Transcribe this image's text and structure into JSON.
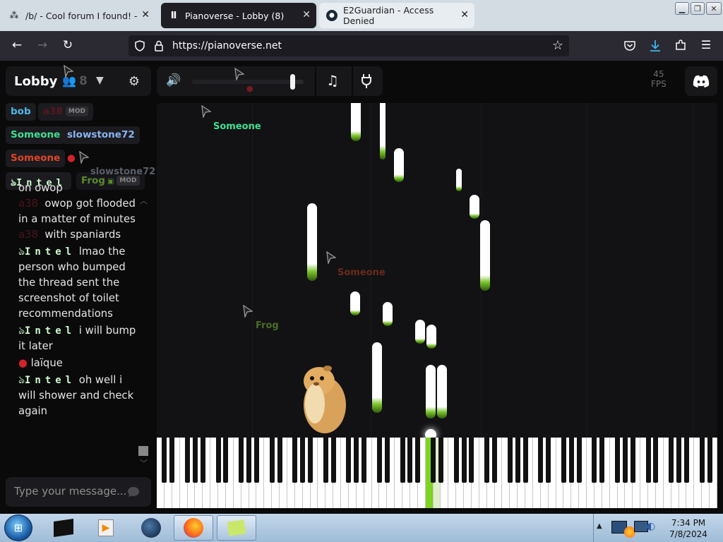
{
  "browser": {
    "tabs": [
      {
        "title": "/b/ - Cool forum I found! - Ran",
        "active": false
      },
      {
        "title": "Pianoverse - Lobby (8)",
        "active": true
      },
      {
        "title": "E2Guardian - Access Denied",
        "active": false
      }
    ],
    "url": "https://pianoverse.net"
  },
  "room": {
    "name": "Lobby",
    "user_count": "8",
    "fps_value": "45",
    "fps_label": "FPS",
    "volume_level": 0.9
  },
  "users": [
    {
      "name": "bob",
      "color": "#4fb7e8"
    },
    {
      "name": "a38",
      "color": "#5a1622",
      "badge": "MOD"
    },
    {
      "name": "Someone",
      "color": "#3ee092"
    },
    {
      "name": "slowstone72",
      "color": "#89b5f2"
    },
    {
      "name": "Someone",
      "color": "#e14426"
    },
    {
      "name": "Intel",
      "color": "#cdfccd"
    },
    {
      "name": "Frog",
      "color": "#5a8a2a",
      "badge": "MOD"
    }
  ],
  "chat": {
    "messages": [
      {
        "user": "",
        "text": "on owop"
      },
      {
        "user": "a38",
        "text": "owop got flooded in a matter of minutes"
      },
      {
        "user": "a38",
        "text": "with spaniards"
      },
      {
        "user": "Intel",
        "text": "lmao the person who bumped the thread sent the screenshot of toilet recommendations"
      },
      {
        "user": "Intel",
        "text": "i will bump it later"
      },
      {
        "user": "🍎",
        "text": "laïque"
      },
      {
        "user": "Intel",
        "text": "oh well i will shower and check again"
      }
    ],
    "placeholder": "Type your message..."
  },
  "cursors": [
    {
      "label": "Someone",
      "color": "#3ee092"
    },
    {
      "label": "Someone",
      "color": "#6a2a1c"
    },
    {
      "label": "Frog",
      "color": "#4a6d22"
    },
    {
      "label": "slowstone72",
      "color": "#5a5f68"
    }
  ],
  "taskbar": {
    "time": "7:34 PM",
    "date": "7/8/2024"
  },
  "icons": [
    "back-icon",
    "forward-icon",
    "reload-icon",
    "shield-icon",
    "lock-icon",
    "star-icon",
    "pocket-icon",
    "download-icon",
    "extensions-icon",
    "menu-icon",
    "gear-icon",
    "volume-icon",
    "music-note-icon",
    "plug-icon",
    "discord-icon",
    "send-icon"
  ]
}
